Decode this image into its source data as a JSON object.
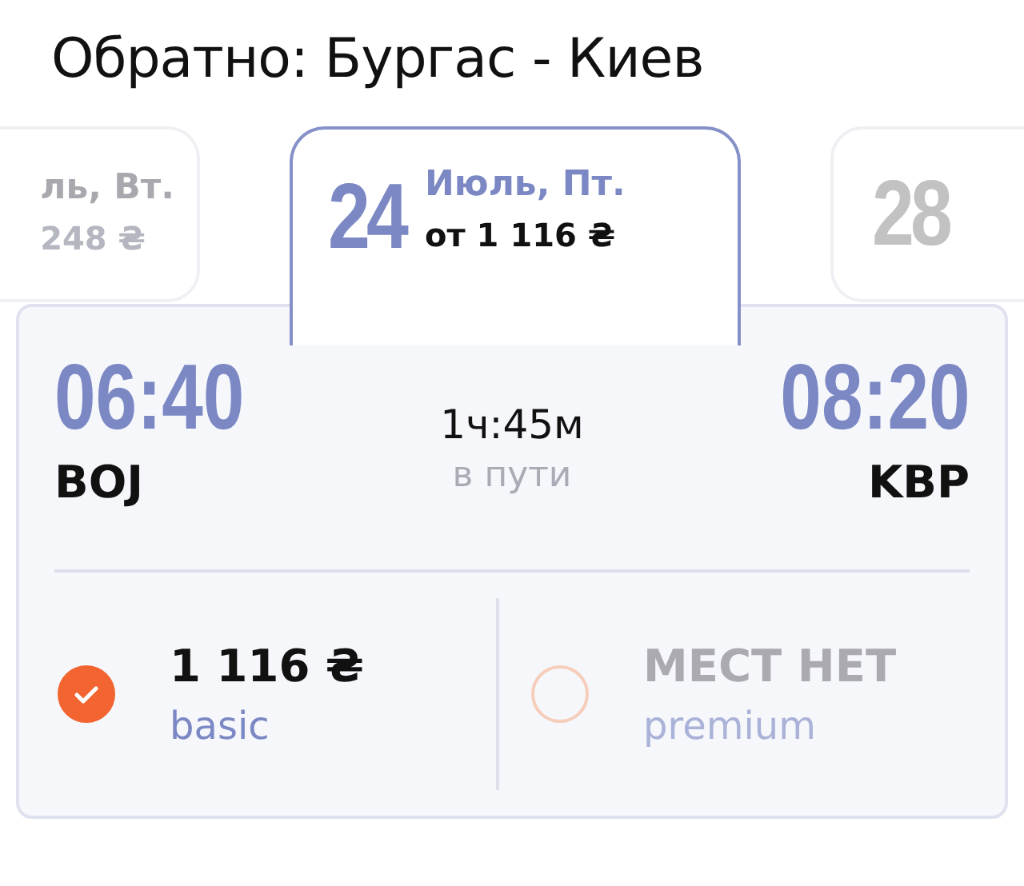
{
  "title": "Обратно: Бургас - Киев",
  "dates": [
    {
      "weekday": "ль, Вт.",
      "price": "248 ₴",
      "selected": false
    },
    {
      "day": "24",
      "weekday": "Июль, Пт.",
      "price": "от 1 116 ₴",
      "selected": true
    },
    {
      "day": "28",
      "selected": false
    }
  ],
  "flight": {
    "departure": {
      "time": "06:40",
      "airport": "BOJ"
    },
    "duration": "1ч:45м",
    "duration_label": "в пути",
    "arrival": {
      "time": "08:20",
      "airport": "KBP"
    }
  },
  "fares": [
    {
      "price": "1 116 ₴",
      "fare_class": "basic",
      "selected": true,
      "available": true
    },
    {
      "price": "МЕСТ НЕТ",
      "fare_class": "premium",
      "selected": false,
      "available": false
    }
  ]
}
